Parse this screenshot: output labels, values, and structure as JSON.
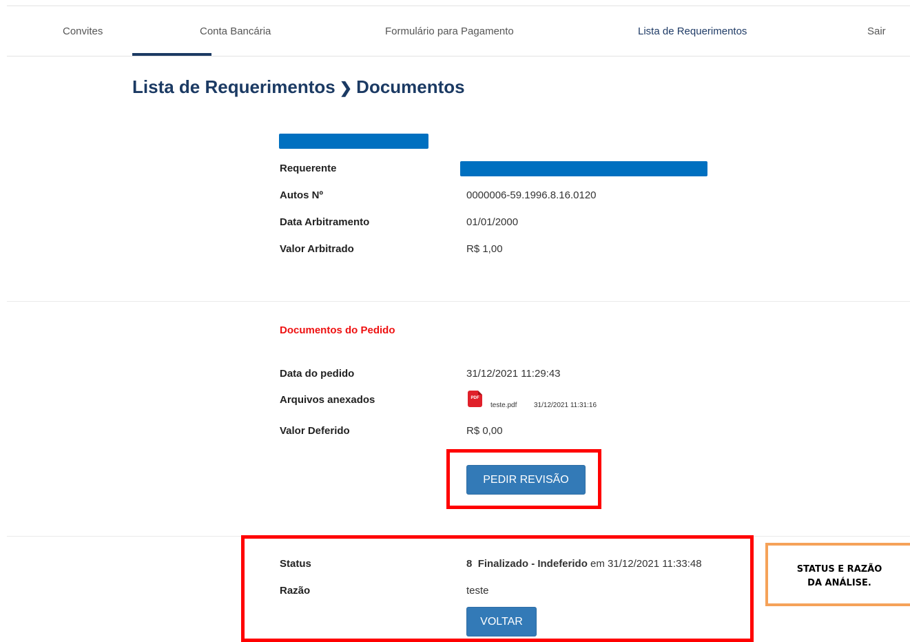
{
  "nav": {
    "items": [
      "Convites",
      "Conta Bancária",
      "Formulário para Pagamento",
      "Lista de Requerimentos",
      "Sair"
    ],
    "active_underline_item": "Conta Bancária",
    "active_text_item": "Lista de Requerimentos"
  },
  "page": {
    "breadcrumb_parent": "Lista de Requerimentos",
    "breadcrumb_separator": "❯",
    "breadcrumb_current": "Documentos"
  },
  "info": {
    "requerente_label": "Requerente",
    "autos_label": "Autos Nº",
    "autos_value": "0000006-59.1996.8.16.0120",
    "data_arbitramento_label": "Data Arbitramento",
    "data_arbitramento_value": "01/01/2000",
    "valor_arbitrado_label": "Valor Arbitrado",
    "valor_arbitrado_value": "R$ 1,00"
  },
  "documentos": {
    "section_title": "Documentos do Pedido",
    "data_pedido_label": "Data do pedido",
    "data_pedido_value": "31/12/2021 11:29:43",
    "arquivos_label": "Arquivos anexados",
    "file": {
      "icon": "pdf-icon",
      "icon_text": "PDF",
      "name": "teste.pdf",
      "date": "31/12/2021 11:31:16"
    },
    "valor_deferido_label": "Valor Deferido",
    "valor_deferido_value": "R$ 0,00",
    "pedir_revisao_label": "PEDIR REVISÃO"
  },
  "analise": {
    "status_label": "Status",
    "status_code": "8",
    "status_text": "Finalizado - Indeferido",
    "status_em": "em",
    "status_date": "31/12/2021 11:33:48",
    "razao_label": "Razão",
    "razao_value": "teste",
    "voltar_label": "VOLTAR"
  },
  "annotation": {
    "callout_text": "STATUS E RAZÃO DA ANÁLISE.",
    "highlight_color": "#ff0000",
    "callout_border_color": "#f5a259"
  },
  "colors": {
    "primary_button": "#337ab7",
    "title": "#1b3a63",
    "section_title": "#ee1111",
    "redaction": "#0070c0"
  }
}
